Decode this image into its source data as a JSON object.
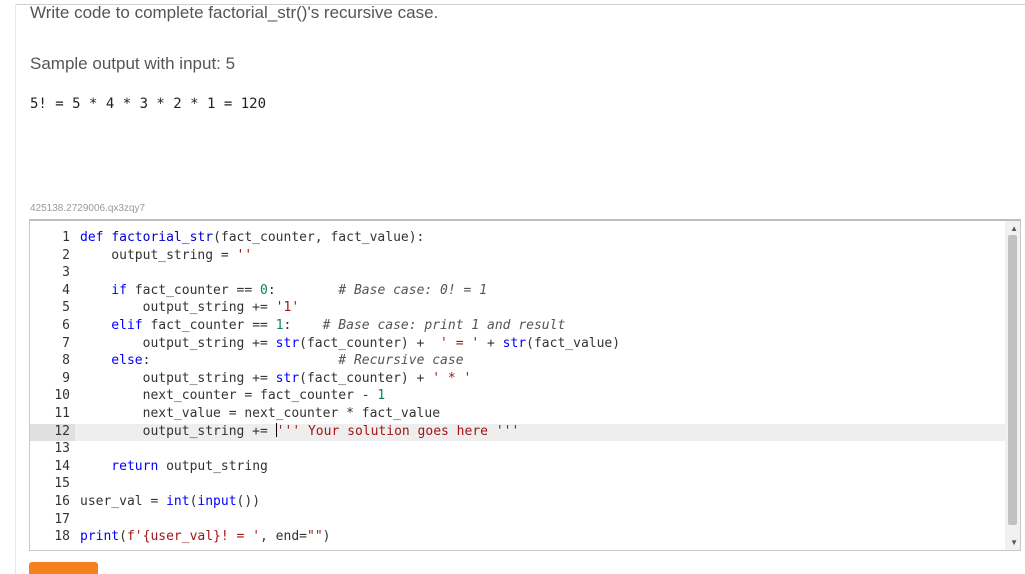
{
  "prompt": "Write code to complete factorial_str()'s recursive case.",
  "sample_label": "Sample output with input: 5",
  "sample_output": "5! = 5 * 4 * 3 * 2 * 1 = 120",
  "problem_id": "425138.2729006.qx3zqy7",
  "editor": {
    "line_numbers": [
      "1",
      "2",
      "3",
      "4",
      "5",
      "6",
      "7",
      "8",
      "9",
      "10",
      "11",
      "12",
      "13",
      "14",
      "15",
      "16",
      "17",
      "18"
    ],
    "active_line": "12",
    "lines": {
      "l1": {
        "kw": "def",
        "fn": "factorial_str",
        "rest": "(fact_counter, fact_value):"
      },
      "l2": {
        "a": "    output_string = ",
        "str": "''"
      },
      "l4": {
        "kw": "    if",
        "a": " fact_counter == ",
        "num": "0",
        "b": ":        ",
        "cmt": "# Base case: 0! = 1"
      },
      "l5": {
        "a": "        output_string += ",
        "str": "'1'"
      },
      "l6": {
        "kw": "    elif",
        "a": " fact_counter == ",
        "num": "1",
        "b": ":    ",
        "cmt": "# Base case: print 1 and result"
      },
      "l7": {
        "a": "        output_string += ",
        "fn": "str",
        "b": "(fact_counter) +  ",
        "str": "' = '",
        "c": " + ",
        "fn2": "str",
        "d": "(fact_value)"
      },
      "l8": {
        "kw": "    else",
        "a": ":                        ",
        "cmt": "# Recursive case"
      },
      "l9": {
        "a": "        output_string += ",
        "fn": "str",
        "b": "(fact_counter) + ",
        "str": "' * '"
      },
      "l10": {
        "a": "        next_counter = fact_counter - ",
        "num": "1"
      },
      "l11": {
        "a": "        next_value = next_counter * fact_value"
      },
      "l12": {
        "a": "        output_string += ",
        "str": "''' Your solution goes here '''"
      },
      "l14": {
        "kw": "    return",
        "a": " output_string"
      },
      "l16": {
        "a": "user_val = ",
        "fn": "int",
        "b": "(",
        "fn2": "input",
        "c": "())"
      },
      "l18": {
        "fn": "print",
        "a": "(",
        "str": "f'{user_val}! = '",
        "b": ", end=",
        "str2": "\"\"",
        "c": ")"
      }
    }
  },
  "colors": {
    "run_button": "#f5801e",
    "keyword": "#0000ff",
    "string": "#a31515",
    "number": "#098658"
  }
}
